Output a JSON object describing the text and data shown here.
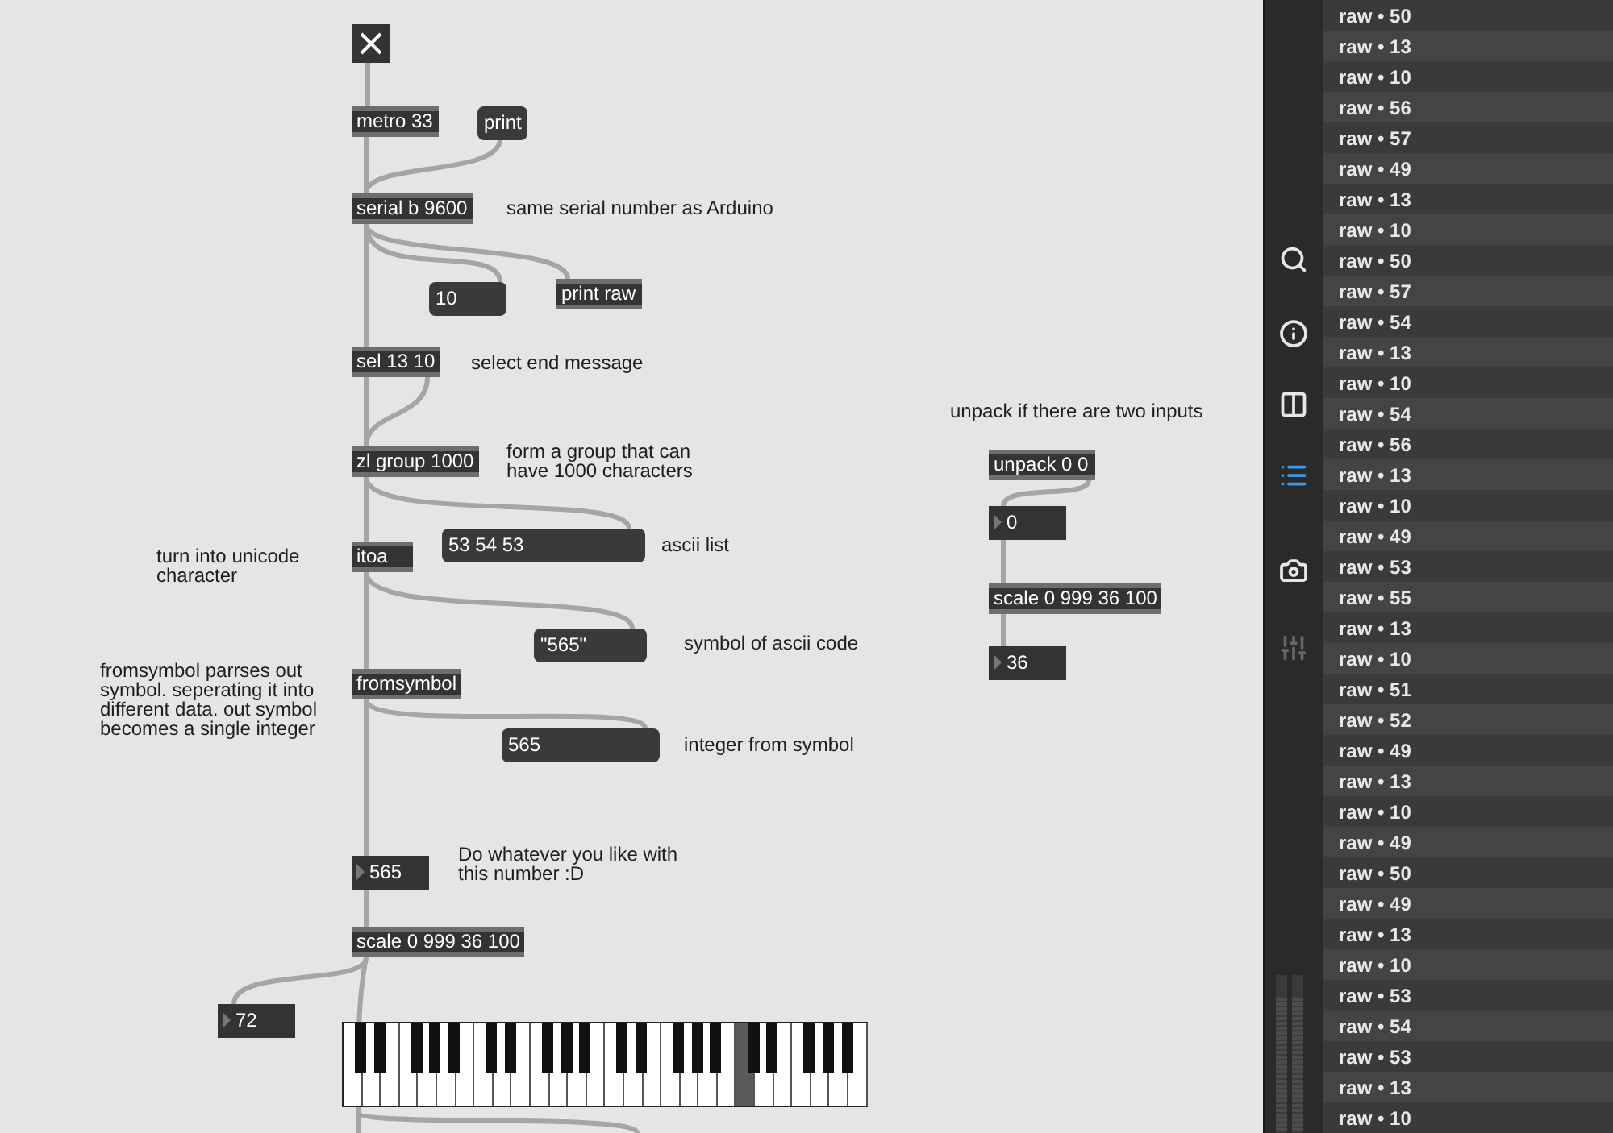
{
  "patcher": {
    "boxes": [
      {
        "kind": "toggle",
        "checked": true
      },
      {
        "kind": "object",
        "text": "metro 33"
      },
      {
        "kind": "message",
        "text": "print"
      },
      {
        "kind": "object",
        "text": "serial b 9600"
      },
      {
        "kind": "comment",
        "text": "same serial number as Arduino"
      },
      {
        "kind": "message",
        "text": "10"
      },
      {
        "kind": "object",
        "text": "print raw"
      },
      {
        "kind": "object",
        "text": "sel 13 10"
      },
      {
        "kind": "comment",
        "text": "select end message"
      },
      {
        "kind": "object",
        "text": "zl group 1000"
      },
      {
        "kind": "comment",
        "text": "form a group that can\nhave 1000 characters"
      },
      {
        "kind": "comment",
        "text": "turn into unicode\ncharacter"
      },
      {
        "kind": "object",
        "text": "itoa"
      },
      {
        "kind": "message",
        "text": "53 54 53"
      },
      {
        "kind": "comment",
        "text": "ascii list"
      },
      {
        "kind": "message",
        "text": "\"565\""
      },
      {
        "kind": "comment",
        "text": "symbol of ascii code"
      },
      {
        "kind": "comment",
        "text": "fromsymbol parrses out\nsymbol. seperating it into\ndifferent data. out symbol\nbecomes a single integer"
      },
      {
        "kind": "object",
        "text": "fromsymbol"
      },
      {
        "kind": "message",
        "text": "565"
      },
      {
        "kind": "comment",
        "text": "integer from symbol"
      },
      {
        "kind": "number",
        "text": "565"
      },
      {
        "kind": "comment",
        "text": "Do whatever you like with\nthis number :D"
      },
      {
        "kind": "object",
        "text": "scale 0 999 36 100"
      },
      {
        "kind": "number",
        "text": "72"
      },
      {
        "kind": "keyboard",
        "white_keys": [
          {
            "selected": false
          },
          {
            "selected": false
          },
          {
            "selected": false
          },
          {
            "selected": false
          },
          {
            "selected": false
          },
          {
            "selected": false
          },
          {
            "selected": false
          },
          {
            "selected": false
          },
          {
            "selected": false
          },
          {
            "selected": false
          },
          {
            "selected": false
          },
          {
            "selected": false
          },
          {
            "selected": false
          },
          {
            "selected": false
          },
          {
            "selected": false
          },
          {
            "selected": false
          },
          {
            "selected": false
          },
          {
            "selected": false
          },
          {
            "selected": false
          },
          {
            "selected": false
          },
          {
            "selected": false
          },
          {
            "selected": true
          },
          {
            "selected": false
          },
          {
            "selected": false
          },
          {
            "selected": false
          },
          {
            "selected": false
          },
          {
            "selected": false
          },
          {
            "selected": false
          }
        ]
      },
      {
        "kind": "comment",
        "text": "unpack if there are two inputs"
      },
      {
        "kind": "object",
        "text": "unpack 0 0"
      },
      {
        "kind": "number",
        "text": "0"
      },
      {
        "kind": "object",
        "text": "scale 0 999 36 100"
      },
      {
        "kind": "number",
        "text": "36"
      }
    ]
  },
  "sidebar": {
    "items": [
      {
        "kind": "search",
        "selected": false,
        "disabled": false
      },
      {
        "kind": "info",
        "selected": false,
        "disabled": false
      },
      {
        "kind": "reference",
        "selected": false,
        "disabled": false
      },
      {
        "kind": "console",
        "selected": true,
        "disabled": false
      },
      {
        "kind": "snapshot",
        "selected": false,
        "disabled": false
      },
      {
        "kind": "mixer",
        "selected": false,
        "disabled": true
      }
    ]
  },
  "console": {
    "rows": [
      "raw • 50",
      "raw • 13",
      "raw • 10",
      "raw • 56",
      "raw • 57",
      "raw • 49",
      "raw • 13",
      "raw • 10",
      "raw • 50",
      "raw • 57",
      "raw • 54",
      "raw • 13",
      "raw • 10",
      "raw • 54",
      "raw • 56",
      "raw • 13",
      "raw • 10",
      "raw • 49",
      "raw • 53",
      "raw • 55",
      "raw • 13",
      "raw • 10",
      "raw • 51",
      "raw • 52",
      "raw • 49",
      "raw • 13",
      "raw • 10",
      "raw • 49",
      "raw • 50",
      "raw • 49",
      "raw • 13",
      "raw • 10",
      "raw • 53",
      "raw • 54",
      "raw • 53",
      "raw • 13",
      "raw • 10"
    ]
  }
}
